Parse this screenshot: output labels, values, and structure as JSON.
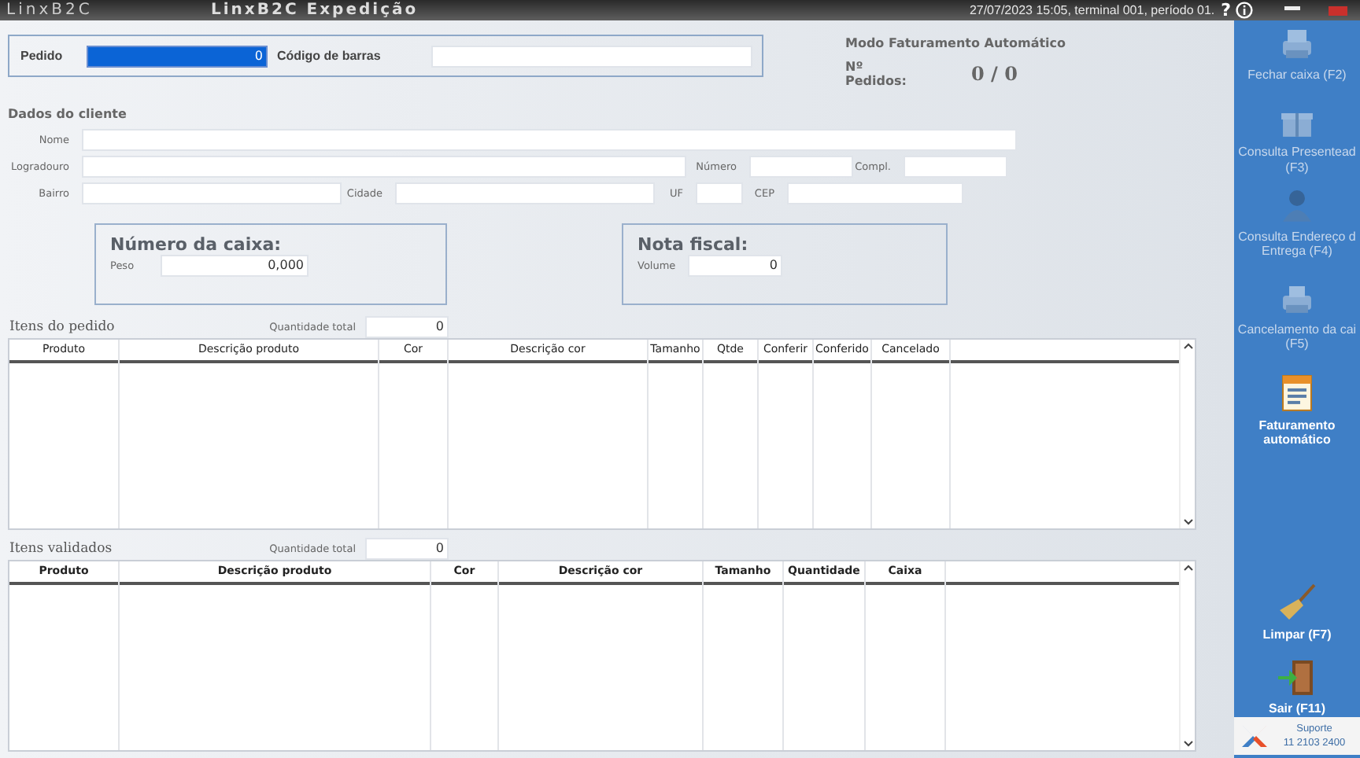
{
  "title_bar": {
    "logo": "LinxB2C",
    "title": "LinxB2C Expedição",
    "status": "27/07/2023 15:05, terminal 001, período 01.",
    "help": "?"
  },
  "order": {
    "pedido_label": "Pedido",
    "pedido_value": "0",
    "barcode_label": "Código de barras"
  },
  "auto_billing": {
    "title": "Modo Faturamento Automático",
    "orders_label": "Nº Pedidos:",
    "orders_value": "0 / 0"
  },
  "client": {
    "title": "Dados do cliente",
    "fields": [
      {
        "label": "Nome"
      },
      {
        "label": "Logradouro"
      },
      {
        "label": "Número"
      },
      {
        "label": "Compl."
      },
      {
        "label": "Bairro"
      },
      {
        "label": "Cidade"
      },
      {
        "label": "UF"
      },
      {
        "label": "CEP"
      }
    ]
  },
  "box": {
    "title": "Número da caixa:",
    "field_label": "Peso",
    "value": "0,000"
  },
  "invoice": {
    "title": "Nota fiscal:",
    "field_label": "Volume",
    "value": "0"
  },
  "order_items": {
    "title": "Itens do pedido",
    "total_label": "Quantidade total",
    "total_value": "0",
    "columns": [
      "Produto",
      "Descrição produto",
      "Cor",
      "Descrição cor",
      "Tamanho",
      "Qtde",
      "Conferir",
      "Conferido",
      "Cancelado"
    ]
  },
  "validated_items": {
    "title": "Itens validados",
    "total_label": "Quantidade total",
    "total_value": "0",
    "columns": [
      "Produto",
      "Descrição produto",
      "Cor",
      "Descrição cor",
      "Tamanho",
      "Quantidade",
      "Caixa"
    ]
  },
  "sidebar": {
    "actions": [
      {
        "lines": [
          "Fechar caixa (F2)"
        ],
        "disabled": true
      },
      {
        "lines": [
          "Consulta Presentead",
          "(F3)"
        ],
        "disabled": true
      },
      {
        "lines": [
          "Consulta Endereço d",
          "Entrega (F4)"
        ],
        "disabled": true
      },
      {
        "lines": [
          "Cancelamento da cai",
          "(F5)"
        ],
        "disabled": true
      },
      {
        "lines": [
          "Faturamento",
          "automático"
        ],
        "disabled": false
      },
      {
        "lines": [
          "Limpar (F7)"
        ],
        "disabled": false
      },
      {
        "lines": [
          "Sair (F11)"
        ],
        "disabled": false
      }
    ],
    "support": {
      "title": "Suporte",
      "phone": "11 2103 2400"
    }
  }
}
